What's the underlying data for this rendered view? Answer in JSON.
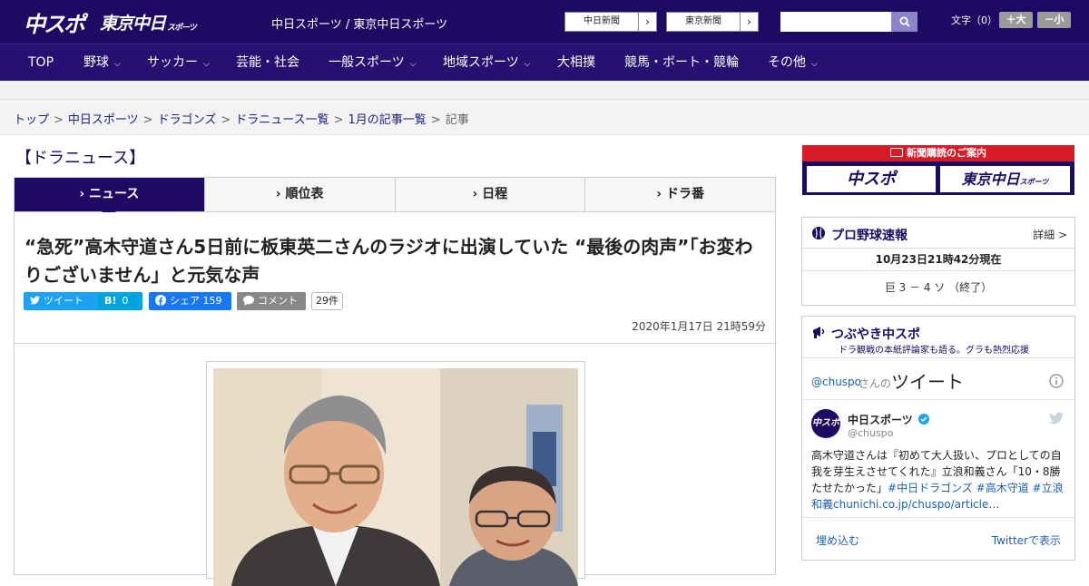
{
  "header": {
    "logo_main": "中スポ",
    "logo_sub": "東京中日",
    "logo_sub_small": "スポーツ",
    "site_title": "中日スポーツ / 東京中日スポーツ",
    "paper_links": [
      {
        "label": "中日新聞",
        "arrow": "›"
      },
      {
        "label": "東京新聞",
        "arrow": "›"
      }
    ],
    "search_placeholder": "",
    "font_size_label": "文字（0）",
    "font_larger": "＋大",
    "font_smaller": "－小"
  },
  "nav": {
    "items": [
      {
        "label": "TOP",
        "dropdown": false
      },
      {
        "label": "野球",
        "dropdown": true
      },
      {
        "label": "サッカー",
        "dropdown": true
      },
      {
        "label": "芸能・社会",
        "dropdown": false
      },
      {
        "label": "一般スポーツ",
        "dropdown": true
      },
      {
        "label": "地域スポーツ",
        "dropdown": true
      },
      {
        "label": "大相撲",
        "dropdown": false
      },
      {
        "label": "競馬・ボート・競輪",
        "dropdown": false
      },
      {
        "label": "その他",
        "dropdown": true
      }
    ]
  },
  "breadcrumb": {
    "items": [
      "トップ",
      "中日スポーツ",
      "ドラゴンズ",
      "ドラニュース一覧",
      "1月の記事一覧"
    ],
    "current": "記事",
    "separator": ">"
  },
  "main": {
    "section_title": "【ドラニュース】",
    "tabs": [
      {
        "label": "ニュース",
        "active": true
      },
      {
        "label": "順位表",
        "active": false
      },
      {
        "label": "日程",
        "active": false
      },
      {
        "label": "ドラ番",
        "active": false
      }
    ],
    "headline": "“急死”高木守道さん5日前に板東英二さんのラジオに出演していた “最後の肉声”「お変わりございません」と元気な声",
    "share": {
      "tweet": "ツイート",
      "hatena": "B!",
      "hatena_count": "0",
      "facebook": "シェア",
      "facebook_count": "159",
      "comment": "コメント",
      "comment_count": "29件"
    },
    "date": "2020年1月17日 21時59分"
  },
  "sidebar": {
    "ad": {
      "title": "新聞購読のご案内",
      "button1": "中スポ",
      "button2": "東京中日",
      "button2_small": "スポーツ"
    },
    "baseball": {
      "title": "プロ野球速報",
      "detail": "詳細 >",
      "timestamp": "10月23日21時42分現在",
      "score": "巨 3 － 4 ソ （終了）"
    },
    "twitter": {
      "title": "つぶやき中スポ",
      "subtitle": "ドラ観戦の本紙評論家も語る。グラも熱烈応援",
      "handle": "@chuspo",
      "handle_suffix": "さんの",
      "tweets_label": "ツイート",
      "account_name": "中日スポーツ",
      "account_handle": "@chuspo",
      "tweet_text": "高木守道さんは『初めて大人扱い、プロとしての自我を芽生えさせてくれた』立浪和義さん「10・8勝たせたかった」",
      "tweet_tags": "#中日ドラゴンズ #高木守道 #立浪和義chunichi.co.jp/chuspo/article…",
      "embed": "埋め込む",
      "view_on": "Twitterで表示"
    }
  },
  "colors": {
    "brand_navy": "#1d0a63",
    "nav_bg": "#241170",
    "accent_red": "#d81b28",
    "twitter_blue": "#1da1f2",
    "facebook_blue": "#1877f2",
    "hatena_blue": "#00a4de"
  }
}
